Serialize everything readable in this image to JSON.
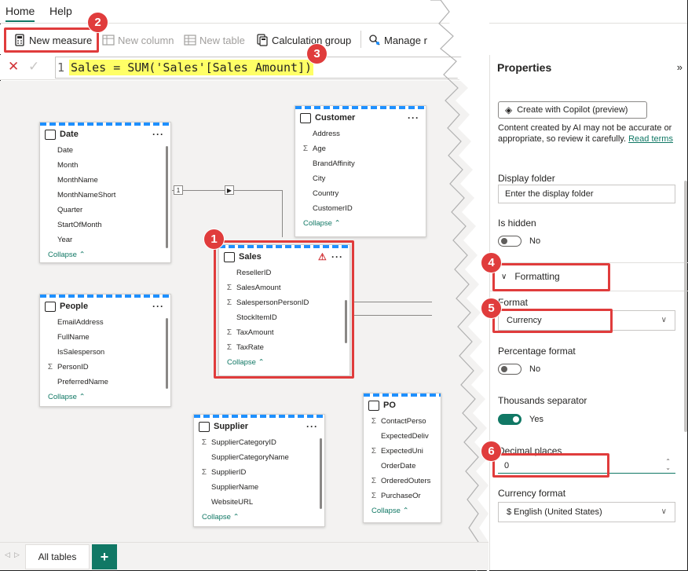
{
  "menu": {
    "tabs": [
      "Home",
      "Help"
    ]
  },
  "ribbon": {
    "new_measure": "New measure",
    "new_column": "New column",
    "new_table": "New table",
    "calculation_group": "Calculation group",
    "manage": "Manage r"
  },
  "formula": {
    "line": "1",
    "code": "Sales = SUM('Sales'[Sales Amount])"
  },
  "tables": {
    "date": {
      "name": "Date",
      "fields": [
        "Date",
        "Month",
        "MonthName",
        "MonthNameShort",
        "Quarter",
        "StartOfMonth",
        "Year"
      ],
      "collapse": "Collapse"
    },
    "customer": {
      "name": "Customer",
      "fields": [
        "Address",
        "Age",
        "BrandAffinity",
        "City",
        "Country",
        "CustomerID"
      ],
      "sigma": [
        false,
        true,
        false,
        false,
        false,
        false
      ],
      "collapse": "Collapse"
    },
    "sales": {
      "name": "Sales",
      "fields": [
        "ResellerID",
        "SalesAmount",
        "SalespersonPersonID",
        "StockItemID",
        "TaxAmount",
        "TaxRate"
      ],
      "sigma": [
        false,
        true,
        true,
        false,
        true,
        true
      ],
      "collapse": "Collapse"
    },
    "people": {
      "name": "People",
      "fields": [
        "EmailAddress",
        "FullName",
        "IsSalesperson",
        "PersonID",
        "PreferredName"
      ],
      "sigma": [
        false,
        false,
        false,
        true,
        false
      ],
      "collapse": "Collapse"
    },
    "supplier": {
      "name": "Supplier",
      "fields": [
        "SupplierCategoryID",
        "SupplierCategoryName",
        "SupplierID",
        "SupplierName",
        "WebsiteURL"
      ],
      "sigma": [
        true,
        false,
        true,
        false,
        false
      ],
      "collapse": "Collapse"
    },
    "po": {
      "name": "PO",
      "fields": [
        "ContactPerso",
        "ExpectedDeliv",
        "ExpectedUni",
        "OrderDate",
        "OrderedOuters",
        "PurchaseOr"
      ],
      "sigma": [
        true,
        false,
        true,
        false,
        true,
        true
      ],
      "collapse": "Collapse"
    }
  },
  "relationships": {
    "one": "1",
    "many": "*"
  },
  "properties": {
    "title": "Properties",
    "copilot_button": "Create with Copilot (preview)",
    "ai_note": "Content created by AI may not be accurate or appropriate, so review it carefully.",
    "ai_link": "Read terms",
    "display_folder_label": "Display folder",
    "display_folder_placeholder": "Enter the display folder",
    "is_hidden_label": "Is hidden",
    "is_hidden_value": "No",
    "formatting_label": "Formatting",
    "format_label": "Format",
    "format_value": "Currency",
    "percentage_label": "Percentage format",
    "percentage_value": "No",
    "thousands_label": "Thousands separator",
    "thousands_value": "Yes",
    "decimal_label": "Decimal places",
    "decimal_value": "0",
    "currency_label": "Currency format",
    "currency_value": "$ English (United States)"
  },
  "bottom": {
    "tab": "All tables",
    "add": "+"
  },
  "callouts": [
    "1",
    "2",
    "3",
    "4",
    "5",
    "6"
  ],
  "colors": {
    "accent": "#117865",
    "callout": "#e03c3c",
    "highlight": "#ffff66",
    "table_stripe": "#1e90ff"
  }
}
